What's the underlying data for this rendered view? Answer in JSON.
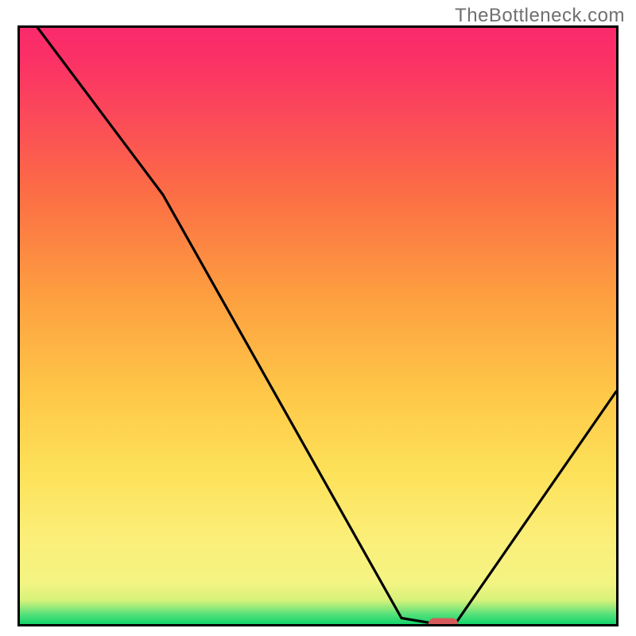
{
  "watermark": "TheBottleneck.com",
  "chart_data": {
    "type": "line",
    "title": "",
    "xlabel": "",
    "ylabel": "",
    "xlim": [
      0,
      100
    ],
    "ylim": [
      0,
      100
    ],
    "grid": false,
    "legend": false,
    "series": [
      {
        "name": "curve",
        "x": [
          3,
          24,
          64,
          70,
          73,
          100
        ],
        "values": [
          100,
          72,
          1,
          0,
          0,
          39
        ]
      }
    ],
    "marker": {
      "x_center": 71,
      "y_center": 0,
      "width": 5,
      "height": 2,
      "color": "#d65a5a"
    },
    "background_gradient": {
      "direction": "vertical",
      "stops": [
        {
          "pct": 0,
          "color": "#14d36a"
        },
        {
          "pct": 1.5,
          "color": "#4fe07a"
        },
        {
          "pct": 4,
          "color": "#d7f27a"
        },
        {
          "pct": 7,
          "color": "#f4f483"
        },
        {
          "pct": 14,
          "color": "#fbef7a"
        },
        {
          "pct": 25,
          "color": "#fde25a"
        },
        {
          "pct": 38,
          "color": "#fec948"
        },
        {
          "pct": 55,
          "color": "#fd9f40"
        },
        {
          "pct": 72,
          "color": "#fc6e45"
        },
        {
          "pct": 85,
          "color": "#fb4a59"
        },
        {
          "pct": 95,
          "color": "#fb3066"
        },
        {
          "pct": 100,
          "color": "#fb2a6c"
        }
      ]
    }
  }
}
